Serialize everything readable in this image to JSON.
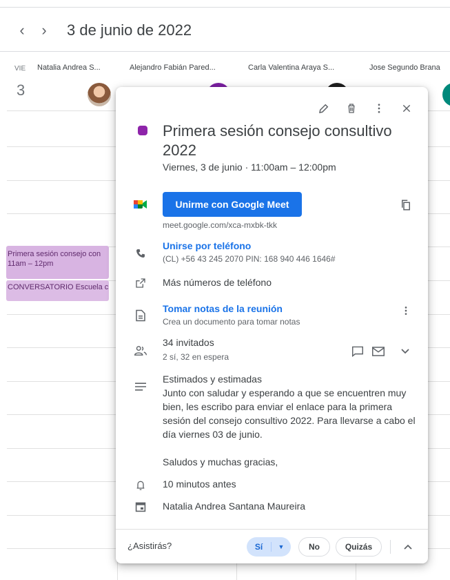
{
  "header": {
    "prev_icon": "chevron-left-icon",
    "next_icon": "chevron-right-icon",
    "date_title": "3 de junio de 2022",
    "prev_glyph": "‹",
    "next_glyph": "›"
  },
  "day": {
    "weekday": "VIE",
    "number": "3"
  },
  "columns": [
    {
      "name": "Natalia Andrea S..."
    },
    {
      "name": "Alejandro Fabián Pared..."
    },
    {
      "name": "Carla Valentina Araya S..."
    },
    {
      "name": "Jose Segundo Brana"
    }
  ],
  "events": [
    {
      "title": "Primera sesión consejo con",
      "time": "11am – 12pm"
    },
    {
      "title": "CONVERSATORIO Escuela c"
    }
  ],
  "popup": {
    "color": "#8e24aa",
    "title": "Primera sesión consejo consultivo 2022",
    "when": "Viernes, 3 de junio  ·  11:00am – 12:00pm",
    "meet": {
      "button_label": "Unirme con Google Meet",
      "url": "meet.google.com/xca-mxbk-tkk"
    },
    "phone": {
      "label": "Unirse por teléfono",
      "detail": "(CL) +56 43 245 2070 PIN: 168 940 446 1646#"
    },
    "more_numbers": "Más números de teléfono",
    "notes": {
      "label": "Tomar notas de la reunión",
      "detail": "Crea un documento para tomar notas"
    },
    "guests": {
      "count": "34 invitados",
      "detail": "2 sí, 32 en espera"
    },
    "description": {
      "line1": "Estimados y estimadas",
      "line2": "Junto con saludar y esperando a que se encuentren muy bien, les escribo para enviar el enlace para la primera sesión del consejo consultivo 2022. Para llevarse a cabo el día viernes 03 de junio.",
      "line3": "Saludos y muchas gracias,"
    },
    "reminder": "10 minutos antes",
    "organizer": "Natalia Andrea Santana Maureira",
    "rsvp": {
      "question": "¿Asistirás?",
      "yes": "Sí",
      "no": "No",
      "maybe": "Quizás"
    }
  }
}
